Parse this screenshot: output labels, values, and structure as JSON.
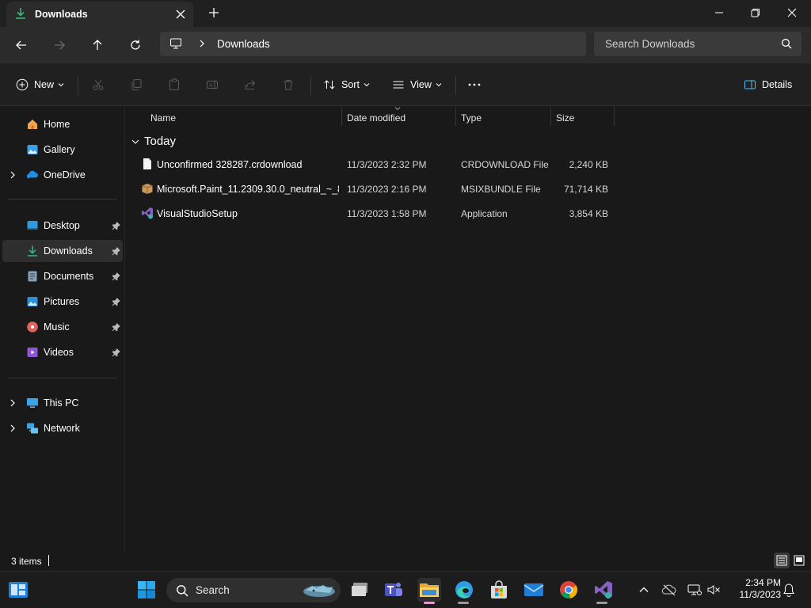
{
  "window": {
    "tab_title": "Downloads",
    "new_tab_symbol": "+"
  },
  "address": {
    "breadcrumb": "Downloads",
    "search_placeholder": "Search Downloads"
  },
  "commandbar": {
    "new_label": "New",
    "sort_label": "Sort",
    "view_label": "View",
    "more_symbol": "···",
    "details_label": "Details"
  },
  "sidebar": {
    "items": [
      {
        "label": "Home",
        "icon": "home-icon"
      },
      {
        "label": "Gallery",
        "icon": "gallery-icon"
      },
      {
        "label": "OneDrive",
        "icon": "onedrive-icon"
      },
      {
        "label": "Desktop",
        "icon": "desktop-icon",
        "pinned": true
      },
      {
        "label": "Downloads",
        "icon": "downloads-icon",
        "pinned": true,
        "selected": true
      },
      {
        "label": "Documents",
        "icon": "documents-icon",
        "pinned": true
      },
      {
        "label": "Pictures",
        "icon": "pictures-icon",
        "pinned": true
      },
      {
        "label": "Music",
        "icon": "music-icon",
        "pinned": true
      },
      {
        "label": "Videos",
        "icon": "videos-icon",
        "pinned": true
      },
      {
        "label": "This PC",
        "icon": "this-pc-icon"
      },
      {
        "label": "Network",
        "icon": "network-icon"
      }
    ]
  },
  "columns": {
    "name": "Name",
    "date": "Date modified",
    "type": "Type",
    "size": "Size"
  },
  "group": {
    "label": "Today"
  },
  "files": [
    {
      "name": "Unconfirmed 328287.crdownload",
      "date": "11/3/2023 2:32 PM",
      "type": "CRDOWNLOAD File",
      "size": "2,240 KB",
      "icon": "document-icon"
    },
    {
      "name": "Microsoft.Paint_11.2309.30.0_neutral_~_8...",
      "date": "11/3/2023 2:16 PM",
      "type": "MSIXBUNDLE File",
      "size": "71,714 KB",
      "icon": "package-icon"
    },
    {
      "name": "VisualStudioSetup",
      "date": "11/3/2023 1:58 PM",
      "type": "Application",
      "size": "3,854 KB",
      "icon": "visual-studio-icon"
    }
  ],
  "status": {
    "item_count": "3 items"
  },
  "taskbar": {
    "search_label": "Search",
    "time": "2:34 PM",
    "date": "11/3/2023"
  },
  "colors": {
    "accent": "#4cc2ff",
    "downloads_green": "#36b37e",
    "background": "#191919"
  }
}
